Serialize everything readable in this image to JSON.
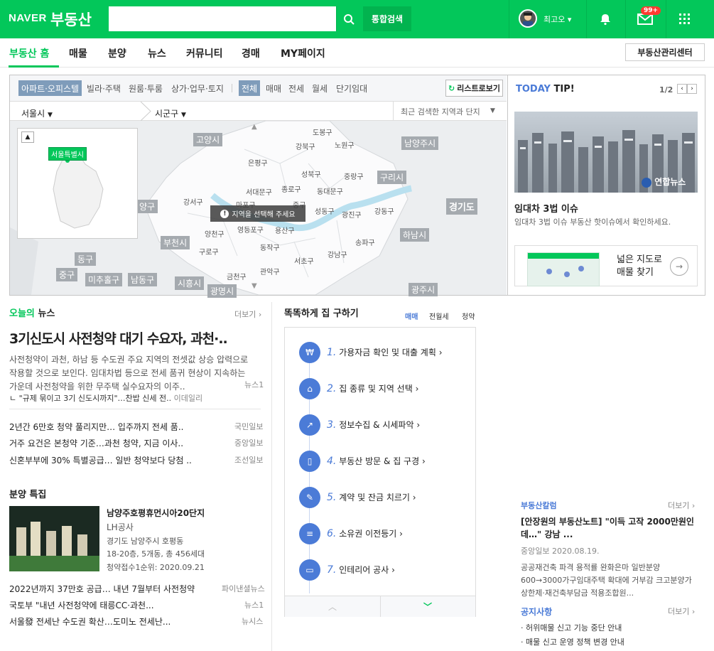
{
  "header": {
    "brand_naver": "NAVER",
    "brand_bds": "부동산",
    "search_placeholder": "",
    "total_search": "통합검색",
    "user": "최고오",
    "badge": "99+"
  },
  "nav": {
    "items": [
      "부동산 홈",
      "매물",
      "분양",
      "뉴스",
      "커뮤니티",
      "경매",
      "MY페이지"
    ],
    "manager": "부동산관리센터"
  },
  "map": {
    "types": [
      "아파트·오피스텔",
      "빌라·주택",
      "원룸·투룸",
      "상가·업무·토지"
    ],
    "deals": [
      "전체",
      "매매",
      "전세",
      "월세",
      "단기임대"
    ],
    "list_button": "리스트로보기",
    "city": "서울시",
    "district": "시군구",
    "recent": "최근 검색한 지역과 단지",
    "minimap_label": "서울특별시",
    "select_msg": "지역을 선택해 주세요",
    "regions": [
      "도봉구",
      "노원구",
      "강북구",
      "은평구",
      "성북구",
      "중랑구",
      "서대문구",
      "종로구",
      "동대문구",
      "강서구",
      "마포구",
      "중구",
      "성동구",
      "광진구",
      "강동구",
      "양천구",
      "영등포구",
      "용산구",
      "동작구",
      "구로구",
      "서초구",
      "강남구",
      "송파구",
      "관악구",
      "금천구"
    ],
    "outside": [
      "고양시",
      "남양주시",
      "구리시",
      "경기도",
      "하남시",
      "양구",
      "부천시",
      "동구",
      "중구",
      "미추홀구",
      "남동구",
      "시흥시",
      "광명시",
      "광주시"
    ]
  },
  "tip": {
    "title_a": "TODAY",
    "title_b": "TIP!",
    "page": "1/2",
    "headline": "임대차 3법 이슈",
    "desc": "임대차 3법 이슈 부동산 핫이슈에서 확인하세요.",
    "credit": "연합뉴스",
    "map_line1": "넓은 지도로",
    "map_line2": "매물 찾기"
  },
  "news": {
    "title_a": "오늘의",
    "title_b": "뉴스",
    "more": "더보기",
    "headline": "3기신도시 사전청약 대기 수요자, 과천·..",
    "summary": "사전청약이 과천, 하남 등 수도권 주요 지역의 전셋값 상승 압력으로 작용할 것으로 보인다. 임대차법 등으로 전세 품귀 현상이 지속하는 가운데 사전청약을 위한 무주택 실수요자의 이주..",
    "summary_src": "뉴스1",
    "sub": "\"규제 묶이고 3기 신도시까지\"…찬밥 신세 전..",
    "sub_src": "이데일리",
    "list": [
      {
        "t": "2년간 6만호 청약 풀리지만… 입주까지 전세 품..",
        "s": "국민일보"
      },
      {
        "t": "거주 요건은 본청약 기준…과천 청약, 지금 이사..",
        "s": "중앙일보"
      },
      {
        "t": "신혼부부에 30% 특별공급… 일반 청약보다 당첨 ..",
        "s": "조선일보"
      }
    ]
  },
  "sale": {
    "title": "분양 특집",
    "name": "남양주호평휴먼시아20단지",
    "co": "LH공사",
    "addr": "경기도 남양주시 호평동",
    "info": "18-20층, 5개동, 총 456세대",
    "date": "청약접수1순위: 2020.09.21",
    "list": [
      {
        "t": "2022년까지 37만호 공급… 내년 7월부터 사전청약",
        "s": "파이낸셜뉴스"
      },
      {
        "t": "국토부 \"내년 사전청약에 태릉CC·과천...",
        "s": "뉴스1"
      },
      {
        "t": "서울發 전세난 수도권 확산…도미노 전세난...",
        "s": "뉴시스"
      }
    ]
  },
  "guide": {
    "title": "똑똑하게 집 구하기",
    "tabs": [
      "매매",
      "전월세",
      "청약"
    ],
    "steps": [
      {
        "n": "1.",
        "t": "가용자금 확인 및 대출 계획"
      },
      {
        "n": "2.",
        "t": "집 종류 및 지역 선택"
      },
      {
        "n": "3.",
        "t": "정보수집 & 시세파악"
      },
      {
        "n": "4.",
        "t": "부동산 방문 & 집 구경"
      },
      {
        "n": "5.",
        "t": "계약 및 잔금 치르기"
      },
      {
        "n": "6.",
        "t": "소유권 이전등기"
      },
      {
        "n": "7.",
        "t": "인테리어 공사"
      }
    ]
  },
  "column": {
    "title": "부동산칼럼",
    "more": "더보기",
    "headline": "[안장원의 부동산노트] \"이득 고작 2000만원인데…\" 강남 ...",
    "src": "중앙일보",
    "date": "2020.08.19.",
    "desc": "공공재건축 파격 용적률 완화은마 일반분양 600→3000가구임대주택 확대에 거부감 크고분양가상한제·재건축부담금 적용조합원..."
  },
  "notice": {
    "title": "공지사항",
    "more": "더보기",
    "items": [
      "허위매물 신고 기능 중단 안내",
      "매물 신고 운영 정책 변경 안내"
    ]
  }
}
